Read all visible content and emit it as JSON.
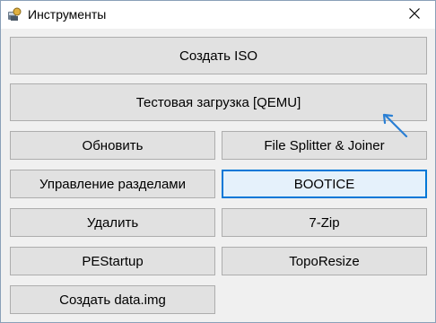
{
  "window": {
    "title": "Инструменты"
  },
  "buttons": {
    "create_iso": "Создать ISO",
    "test_boot": "Тестовая загрузка [QEMU]",
    "refresh": "Обновить",
    "file_splitter": "File Splitter & Joiner",
    "partition_manager": "Управление разделами",
    "bootice": "BOOTICE",
    "delete": "Удалить",
    "seven_zip": "7-Zip",
    "pestartup": "PEStartup",
    "toporesize": "TopoResize",
    "create_data_img": "Создать data.img"
  },
  "icons": {
    "app": "app-tools-icon",
    "close": "close-icon",
    "cursor": "resize-cursor-icon"
  },
  "colors": {
    "focus_border": "#0078d7",
    "button_face": "#e1e1e1",
    "window_bg": "#f0f0f0"
  }
}
